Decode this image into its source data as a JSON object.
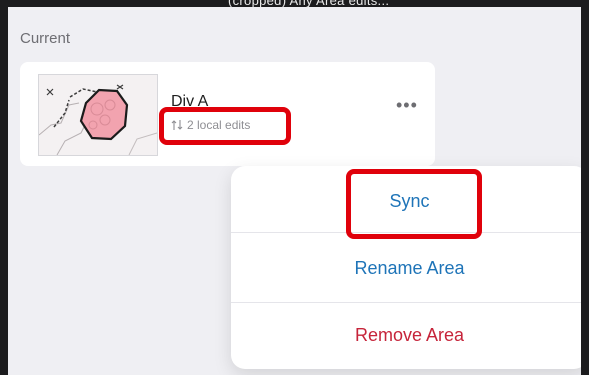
{
  "header": {
    "partial_text": "(cropped) Any Area edits..."
  },
  "section": {
    "title": "Current"
  },
  "area_card": {
    "name": "Div A",
    "edits_label": "2 local edits",
    "sync_icon": "sync-arrows-icon",
    "more_icon": "more-ellipsis-icon",
    "more_label": "•••"
  },
  "menu": {
    "items": [
      {
        "label": "Sync",
        "color": "#1e74b8"
      },
      {
        "label": "Rename Area",
        "color": "#1e74b8"
      },
      {
        "label": "Remove Area",
        "color": "#c6243a"
      }
    ]
  },
  "colors": {
    "highlight": "#e0010b",
    "background": "#efeff3"
  }
}
